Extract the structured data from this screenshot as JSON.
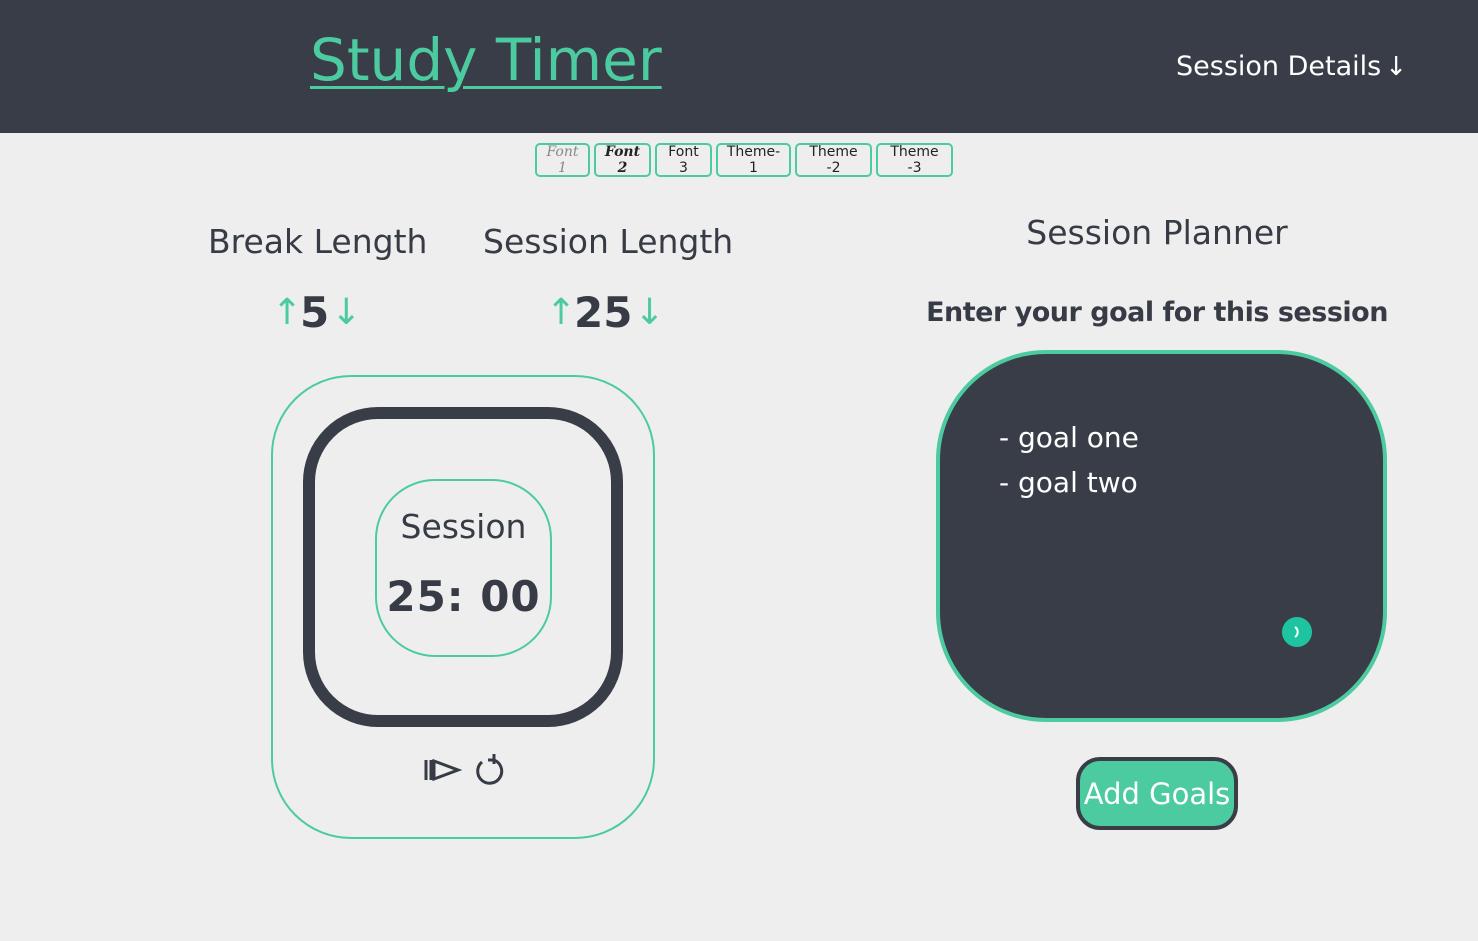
{
  "header": {
    "title": "Study Timer",
    "session_details_label": "Session Details",
    "session_details_arrow": "↓"
  },
  "toolbar": {
    "buttons": [
      {
        "label": "Font 1"
      },
      {
        "label": "Font 2"
      },
      {
        "label": "Font 3"
      },
      {
        "label": "Theme-1"
      },
      {
        "label": "Theme -2"
      },
      {
        "label": "Theme -3"
      }
    ]
  },
  "break": {
    "label": "Break Length",
    "value": "5",
    "up_arrow": "↑",
    "down_arrow": "↓"
  },
  "session": {
    "label": "Session Length",
    "value": "25",
    "up_arrow": "↑",
    "down_arrow": "↓"
  },
  "timer": {
    "label": "Session",
    "time": "25: 00",
    "controls": [
      "play-pause-icon",
      "reset-icon"
    ]
  },
  "planner": {
    "title": "Session Planner",
    "prompt": "Enter your goal for this session",
    "goals": [
      "- goal one",
      "- goal two"
    ],
    "add_button_label": "Add Goals"
  },
  "colors": {
    "accent": "#4dcba0",
    "dark": "#383d47",
    "background": "#eeeeee"
  }
}
